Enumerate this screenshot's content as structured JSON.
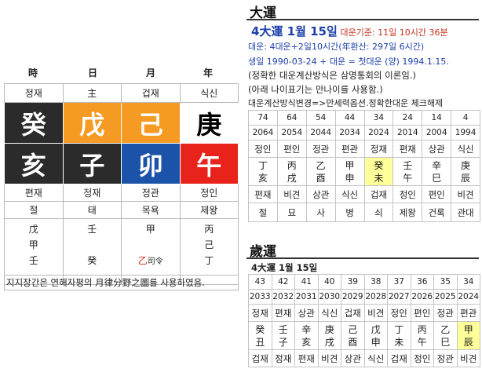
{
  "pillars": {
    "headers": [
      "時",
      "日",
      "月",
      "年"
    ],
    "stem_gods": [
      "정재",
      "主",
      "겁재",
      "식신"
    ],
    "stems": [
      {
        "char": "癸",
        "color": "#2b2b2b",
        "text_color": "#ffffff"
      },
      {
        "char": "戊",
        "color": "#f59a23",
        "text_color": "#ffffff"
      },
      {
        "char": "己",
        "color": "#f59a23",
        "text_color": "#ffffff"
      },
      {
        "char": "庚",
        "color": "#ffffff",
        "text_color": "#000000"
      }
    ],
    "branches": [
      {
        "char": "亥",
        "color": "#2b2b2b",
        "text_color": "#ffffff"
      },
      {
        "char": "子",
        "color": "#2b2b2b",
        "text_color": "#ffffff"
      },
      {
        "char": "卯",
        "color": "#1a53a8",
        "text_color": "#ffffff"
      },
      {
        "char": "午",
        "color": "#e8231c",
        "text_color": "#ffffff"
      }
    ],
    "branch_gods": [
      "편재",
      "정재",
      "정관",
      "정인"
    ],
    "twelve_stages": [
      "절",
      "태",
      "목욕",
      "제왕"
    ],
    "hidden_stems": [
      [
        "戊",
        "甲",
        "壬"
      ],
      [
        "壬",
        "",
        "癸"
      ],
      [
        "甲",
        "",
        ""
      ],
      [
        "丙",
        "己",
        "丁"
      ]
    ],
    "month_branch_extra": {
      "char": "乙",
      "label": "司令"
    },
    "note": "지지장간은 연해자평의 月律分野之圖를 사용하였음."
  },
  "daeun": {
    "title": "大運",
    "headline": "4大運 1월 15일",
    "headline_suffix": "대운기준: 11일 10시간 36분",
    "line2": "대운: 4대운+2일10시간(年환산: 297일 6시간)",
    "line3": "생일 1990-03-24 + 대운 = 첫대운 (양) 1994.1.15.",
    "line4": "(정확한 대운계산방식은 삼명통회의 이론임.)",
    "line5": "(아래 나이표기는 만나이를 사용함.)",
    "line6": "대운계산방식변경=>만세력옵션.정확한대운 체크해제",
    "ages": [
      "74",
      "64",
      "54",
      "44",
      "34",
      "24",
      "14",
      "4"
    ],
    "years": [
      "2064",
      "2054",
      "2044",
      "2034",
      "2024",
      "2014",
      "2004",
      "1994"
    ],
    "stem_gods": [
      "정인",
      "편인",
      "정관",
      "편관",
      "정재",
      "편재",
      "상관",
      "식신"
    ],
    "ganzhi": [
      [
        "丁",
        "亥"
      ],
      [
        "丙",
        "戌"
      ],
      [
        "乙",
        "酉"
      ],
      [
        "甲",
        "申"
      ],
      [
        "癸",
        "未"
      ],
      [
        "壬",
        "午"
      ],
      [
        "辛",
        "巳"
      ],
      [
        "庚",
        "辰"
      ]
    ],
    "highlight_index": 4,
    "branch_gods": [
      "편재",
      "비견",
      "상관",
      "식신",
      "겁재",
      "정인",
      "편인",
      "비견"
    ],
    "stages": [
      "절",
      "묘",
      "사",
      "병",
      "쇠",
      "제왕",
      "건록",
      "관대"
    ]
  },
  "seun": {
    "title": "歲運",
    "headline": "4大運 1월 15일",
    "ages": [
      "43",
      "42",
      "41",
      "40",
      "39",
      "38",
      "37",
      "36",
      "35",
      "34"
    ],
    "years": [
      "2033",
      "2032",
      "2031",
      "2030",
      "2029",
      "2028",
      "2027",
      "2026",
      "2025",
      "2024"
    ],
    "stem_gods": [
      "정재",
      "편재",
      "상관",
      "식신",
      "겁재",
      "비견",
      "정인",
      "편인",
      "정관",
      "편관"
    ],
    "ganzhi": [
      [
        "癸",
        "丑"
      ],
      [
        "壬",
        "子"
      ],
      [
        "辛",
        "亥"
      ],
      [
        "庚",
        "戌"
      ],
      [
        "己",
        "酉"
      ],
      [
        "戊",
        "申"
      ],
      [
        "丁",
        "未"
      ],
      [
        "丙",
        "午"
      ],
      [
        "乙",
        "巳"
      ],
      [
        "甲",
        "辰"
      ]
    ],
    "highlight_index": 9,
    "branch_gods": [
      "겁재",
      "정재",
      "편재",
      "비견",
      "상관",
      "식신",
      "겁재",
      "정인",
      "정관",
      "비견"
    ]
  }
}
